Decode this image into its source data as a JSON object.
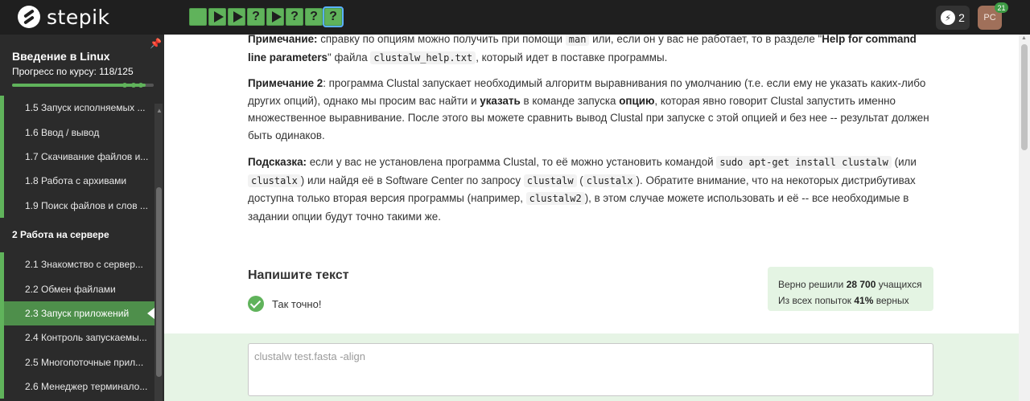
{
  "header": {
    "logo_text": "stepik",
    "steps": [
      {
        "kind": "done",
        "glyph": ""
      },
      {
        "kind": "play",
        "glyph": ""
      },
      {
        "kind": "play",
        "glyph": ""
      },
      {
        "kind": "quiz",
        "glyph": "?"
      },
      {
        "kind": "play",
        "glyph": ""
      },
      {
        "kind": "quiz",
        "glyph": "?"
      },
      {
        "kind": "quiz",
        "glyph": "?"
      },
      {
        "kind": "quiz-active",
        "glyph": "?"
      }
    ],
    "energy_count": "2",
    "avatar_initials": "PC",
    "notifications_count": "21"
  },
  "sidebar": {
    "course_title": "Введение в Linux",
    "progress_text": "Прогресс по курсу:  118/125",
    "progress": {
      "done": 118,
      "total": 125
    },
    "items": [
      {
        "label": "1.5  Запуск исполняемых ...",
        "type": "lesson"
      },
      {
        "label": "1.6  Ввод / вывод",
        "type": "lesson"
      },
      {
        "label": "1.7  Скачивание файлов и...",
        "type": "lesson"
      },
      {
        "label": "1.8  Работа с архивами",
        "type": "lesson"
      },
      {
        "label": "1.9  Поиск файлов и слов ...",
        "type": "lesson"
      },
      {
        "label": "2  Работа на сервере",
        "type": "section"
      },
      {
        "label": "2.1  Знакомство с сервер...",
        "type": "lesson"
      },
      {
        "label": "2.2  Обмен файлами",
        "type": "lesson"
      },
      {
        "label": "2.3  Запуск приложений",
        "type": "lesson-active"
      },
      {
        "label": "2.4  Контроль запускаемы...",
        "type": "lesson"
      },
      {
        "label": "2.5  Многопоточные прил...",
        "type": "lesson"
      },
      {
        "label": "2.6  Менеджер терминало...",
        "type": "lesson"
      }
    ]
  },
  "content": {
    "note1": {
      "label": "Примечание:",
      "t1": " справку по опциям можно получить при помощи ",
      "code1": "man",
      "t2": " или, если он у вас не работает, то в разделе \"",
      "bold2": "Help for command line parameters",
      "t3": "\" файла ",
      "code2": "clustalw_help.txt",
      "t4": ", который идет в поставке программы."
    },
    "note2": {
      "label": "Примечание 2",
      "t1": ": программа Clustal запускает необходимый алгоритм выравнивания по умолчанию (т.е. если ему не указать каких-либо других опций), однако мы просим вас найти и ",
      "bold1": "указать",
      "t2": " в команде запуска ",
      "bold2": "опцию",
      "t3": ", которая явно говорит Clustal запустить именно множественное выравнивание. После этого вы можете сравнить вывод Clustal при запуске с этой опцией и без нее -- результат должен быть одинаков."
    },
    "hint": {
      "label": "Подсказка:",
      "t1": " если у вас не установлена программа Clustal, то её можно установить командой ",
      "code1": "sudo apt-get install clustalw",
      "t2": " (или ",
      "code2": "clustalx",
      "t3": ") или найдя её в Software Center по запросу ",
      "code3": "clustalw",
      "t4": " (",
      "code4": "clustalx",
      "t5": "). Обратите внимание, что на некоторых дистрибутивах доступна только вторая версия программы (например, ",
      "code5": "clustalw2",
      "t6": "), в этом случае можете использовать и её -- все необходимые в задании опции будут точно такими же."
    },
    "task_title": "Напишите текст",
    "result_text": "Так точно!",
    "stats": {
      "line1_prefix": "Верно решили ",
      "line1_count": "28 700",
      "line1_suffix": " учащихся",
      "line2_prefix": "Из всех попыток ",
      "line2_percent": "41%",
      "line2_suffix": " верных"
    },
    "answer_value": "clustalw test.fasta -align"
  },
  "colors": {
    "accent": "#60b35b",
    "topbar": "#1f1f1f",
    "sidebar": "#2b2b2b",
    "active_item": "#4e8f4b",
    "answer_bg": "#e6f4e5",
    "stats_bg": "#e4f4e3"
  }
}
